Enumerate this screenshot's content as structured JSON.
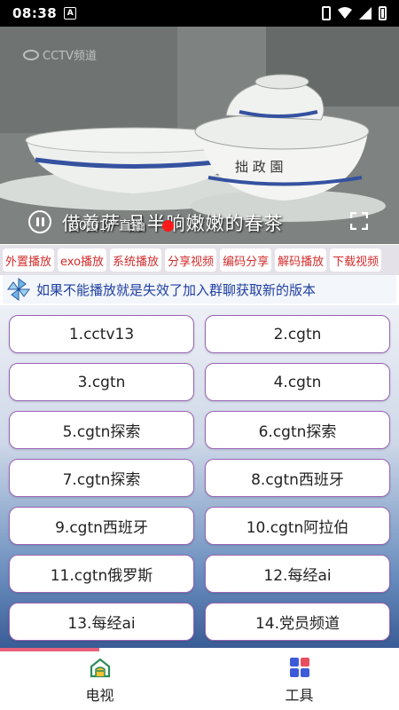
{
  "status_bar": {
    "time": "08:38",
    "notification_icon": "a-letter-icon",
    "icons": [
      "phone-icon",
      "wifi-icon",
      "signal-icon",
      "battery-icon"
    ]
  },
  "video": {
    "watermark": "CCTV频道",
    "overlay_text": "借着萨    品半晌嫩嫩的春茶",
    "time": "00:01 / 直播",
    "progress": 0.0,
    "accent_color": "#ff1a1a"
  },
  "controls": [
    {
      "label": "外置播放"
    },
    {
      "label": "exo播放"
    },
    {
      "label": "系统播放"
    },
    {
      "label": "分享视频"
    },
    {
      "label": "编码分享"
    },
    {
      "label": "解码播放"
    },
    {
      "label": "下载视频"
    }
  ],
  "notice": {
    "icon": "pinwheel-icon",
    "text": "如果不能播放就是失效了加入群聊获取新的版本"
  },
  "channels": [
    {
      "label": "1.cctv13"
    },
    {
      "label": "2.cgtn"
    },
    {
      "label": "3.cgtn"
    },
    {
      "label": "4.cgtn"
    },
    {
      "label": "5.cgtn探索"
    },
    {
      "label": "6.cgtn探索"
    },
    {
      "label": "7.cgtn探索"
    },
    {
      "label": "8.cgtn西班牙"
    },
    {
      "label": "9.cgtn西班牙"
    },
    {
      "label": "10.cgtn阿拉伯"
    },
    {
      "label": "11.cgtn俄罗斯"
    },
    {
      "label": "12.每经ai"
    },
    {
      "label": "13.每经ai"
    },
    {
      "label": "14.党员频道"
    }
  ],
  "bottom_nav": {
    "tv": {
      "label": "电视",
      "icon": "tv-home-icon",
      "color": "#2e8b57"
    },
    "tools": {
      "label": "工具",
      "icon": "tools-grid-icon",
      "color": "#3d5bd9"
    }
  }
}
